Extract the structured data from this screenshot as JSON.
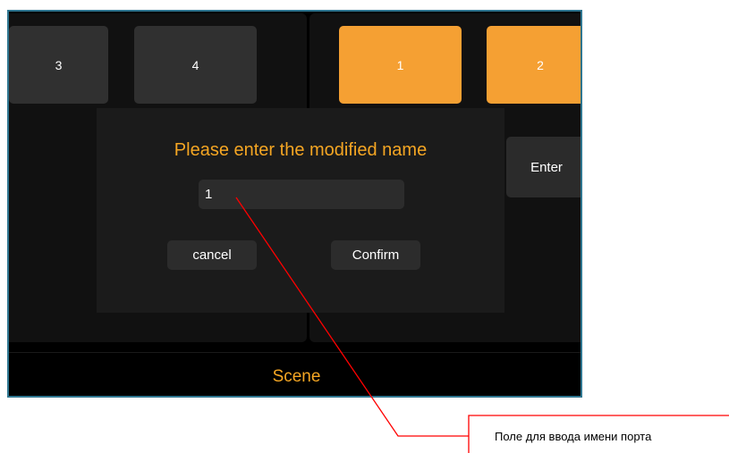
{
  "port_buttons": [
    {
      "label": "3",
      "state": "inactive"
    },
    {
      "label": "4",
      "state": "inactive"
    },
    {
      "label": "1",
      "state": "active"
    },
    {
      "label": "2",
      "state": "active"
    }
  ],
  "enter_label": "Enter",
  "scene_label": "Scene",
  "dialog": {
    "title": "Please enter the modified name",
    "input_value": "1",
    "cancel_label": "cancel",
    "confirm_label": "Confirm"
  },
  "annotation": {
    "text": "Поле для ввода имени порта"
  },
  "colors": {
    "accent": "#f5a623",
    "active_button": "#f5a033",
    "inactive_button": "#303030",
    "screen_border": "#2f7690",
    "callout_line": "#ff0000"
  }
}
